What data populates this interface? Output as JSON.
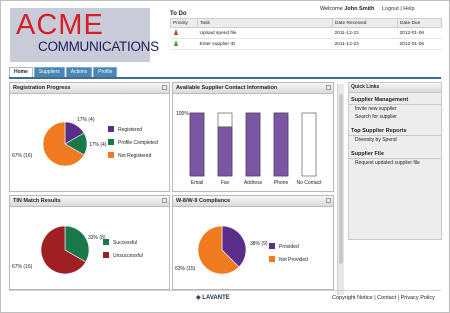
{
  "brand": {
    "line1": "ACME",
    "line2": "COMMUNICATIONS"
  },
  "header": {
    "welcome": "Welcome",
    "user": "John Smith",
    "logout": "Logout",
    "help": "Help",
    "sep": "|"
  },
  "todo": {
    "title": "To Do",
    "columns": [
      "Priority",
      "Task",
      "Date Received",
      "Date Due"
    ],
    "rows": [
      {
        "task": "Upload spend file",
        "received": "2011-12-23",
        "due": "2012-01-06",
        "priority_color": "#d9332b"
      },
      {
        "task": "Enter supplier ID",
        "received": "2011-12-23",
        "due": "2012-01-06",
        "priority_color": "#3a9a3a"
      }
    ]
  },
  "tabs": [
    "Home",
    "Suppliers",
    "Actions",
    "Profile"
  ],
  "panels": {
    "registration": {
      "title": "Registration Progress",
      "chart_data": {
        "type": "pie",
        "categories": [
          "Registered",
          "Profile Completed",
          "Not Registered"
        ],
        "values": [
          4,
          4,
          16
        ],
        "data_labels": [
          "17% (4)",
          "17% (4)",
          "67% (16)"
        ],
        "colors": [
          "#5a2d8c",
          "#19794a",
          "#f07a20"
        ]
      }
    },
    "contact": {
      "title": "Available Supplier Contact Information",
      "chart_data": {
        "type": "bar",
        "categories": [
          "Email",
          "Fax",
          "Address",
          "Phone",
          "No Contact"
        ],
        "values": [
          100,
          78,
          100,
          100,
          0
        ],
        "ytick": "100%",
        "ylim": [
          0,
          100
        ],
        "color": "#7a56a4"
      }
    },
    "tin": {
      "title": "TIN Match Results",
      "chart_data": {
        "type": "pie",
        "categories": [
          "Successful",
          "Unsuccessful"
        ],
        "values": [
          8,
          16
        ],
        "data_labels": [
          "33% (8)",
          "67% (16)"
        ],
        "colors": [
          "#19794a",
          "#a01f24"
        ]
      }
    },
    "w8w9": {
      "title": "W-8/W-9 Compliance",
      "chart_data": {
        "type": "pie",
        "categories": [
          "Provided",
          "Not Provided"
        ],
        "values": [
          9,
          15
        ],
        "data_labels": [
          "38% (9)",
          "63% (15)"
        ],
        "colors": [
          "#5a2d8c",
          "#f07a20"
        ]
      }
    }
  },
  "quick_links": {
    "title": "Quick Links",
    "sections": [
      {
        "heading": "Supplier Management",
        "items": [
          "Invite new supplier",
          "Search for supplier"
        ]
      },
      {
        "heading": "Top Supplier Reports",
        "items": [
          "Diversity by Spend"
        ]
      },
      {
        "heading": "Supplier File",
        "items": [
          "Request updated supplier file"
        ]
      }
    ]
  },
  "footer": {
    "logo": "LAVANTE",
    "copyright": "Copyright Notice",
    "contact": "Contact",
    "privacy": "Privacy Policy",
    "sep": "|"
  }
}
